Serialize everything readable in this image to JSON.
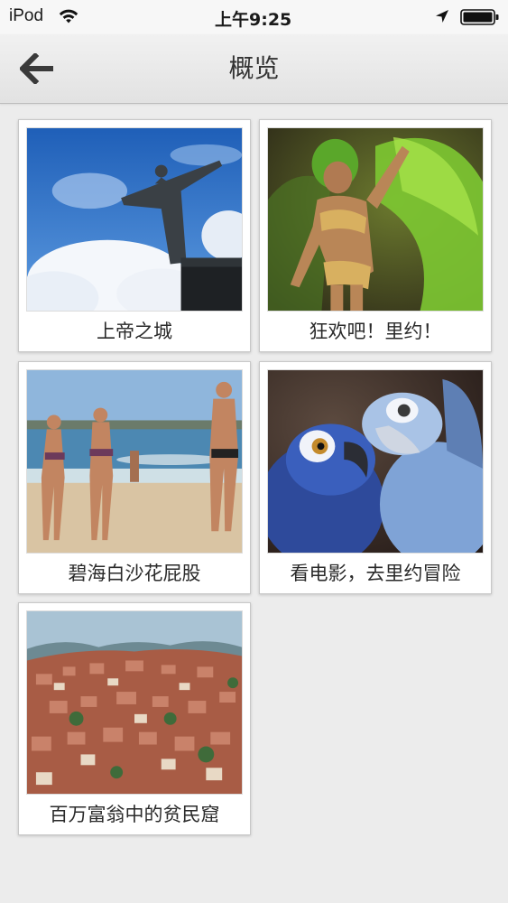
{
  "status_bar": {
    "carrier": "iPod",
    "time": "上午9:25",
    "wifi_icon": "wifi-icon",
    "location_icon": "location-arrow-icon",
    "battery_icon": "battery-icon"
  },
  "nav": {
    "title": "概览",
    "back_icon": "arrow-left-icon"
  },
  "gallery": {
    "items": [
      {
        "caption": "上帝之城",
        "image": "christ-the-redeemer-statue-photo"
      },
      {
        "caption": "狂欢吧！里约！",
        "image": "carnival-dancer-photo"
      },
      {
        "caption": "碧海白沙花屁股",
        "image": "beach-bikini-photo"
      },
      {
        "caption": "看电影，去里约冒险",
        "image": "rio-movie-blue-macaws-photo"
      },
      {
        "caption": "百万富翁中的贫民窟",
        "image": "favela-hillside-photo"
      }
    ]
  },
  "colors": {
    "background": "#ececec",
    "nav_background": "#e8e8e8",
    "card_background": "#ffffff"
  }
}
